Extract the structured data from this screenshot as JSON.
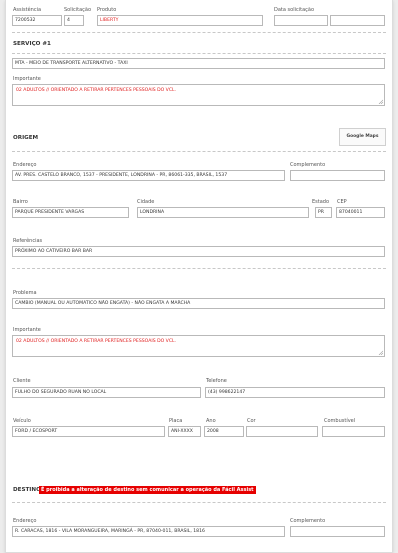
{
  "header": {
    "assistencia_label": "Assistência",
    "assistencia_value": "7200532",
    "solicitacao_label": "Solicitação",
    "solicitacao_value": "4",
    "produto_label": "Produto",
    "produto_value": "LIBERTY",
    "data_solicitacao_label": "Data solicitação",
    "data_value_1": "",
    "data_value_2": ""
  },
  "servico": {
    "title": "SERVIÇO #1",
    "service_value": "MTA - MEIO DE TRANSPORTE ALTERNATIVO - TAXI",
    "importante_label": "Importante",
    "importante_value": "02 ADULTOS // ORIENTADO A RETIRAR PERTENCES PESSOAIS  DO VCL."
  },
  "origem": {
    "title": "ORIGEM",
    "maps_button": "Google Maps",
    "endereco_label": "Endereço",
    "endereco_value": "AV. PRES. CASTELO BRANCO, 1537 - PRESIDENTE, LONDRINA - PR, 86061-335, BRASIL, 1537",
    "complemento_label": "Complemento",
    "complemento_value": "",
    "bairro_label": "Bairro",
    "bairro_value": "PARQUE PRESIDENTE VARGAS",
    "cidade_label": "Cidade",
    "cidade_value": "LONDRINA",
    "estado_label": "Estado",
    "estado_value": "PR",
    "cep_label": "CEP",
    "cep_value": "87040011",
    "referencias_label": "Referências",
    "referencias_value": "PRÓXIMO AO CATIVEIRO BAR BAR"
  },
  "problema": {
    "problema_label": "Problema",
    "problema_value": "CAMBIO (MANUAL OU AUTOMATICO NÃO ENGATA) - NÃO ENGATA A MARCHA",
    "importante_label": "Importante",
    "importante_value": "02 ADULTOS // ORIENTADO A RETIRAR PERTENCES PESSOAIS  DO VCL.",
    "cliente_label": "Cliente",
    "cliente_value": "FULHO DO SEGURADO RUAN NO LOCAL",
    "telefone_label": "Telefone",
    "telefone_value": "(43) 998622147",
    "veiculo_label": "Veículo",
    "veiculo_value": "FORD / ECOSPORT",
    "placa_label": "Placa",
    "placa_value": "ANI-XXXX",
    "ano_label": "Ano",
    "ano_value": "2008",
    "cor_label": "Cor",
    "cor_value": "",
    "combustivel_label": "Combustível",
    "combustivel_value": ""
  },
  "destino": {
    "title": "DESTINO",
    "warning": "É proibida a alteração de destino sem comunicar a operação da Fácil Assist",
    "warning_color": "#e60000",
    "endereco_label": "Endereço",
    "endereco_value": "R. CARACAS, 1816 - VILA MORANGUEIRA, MARINGÁ - PR, 87040-011, BRASIL, 1816",
    "complemento_label": "Complemento",
    "complemento_value": ""
  }
}
